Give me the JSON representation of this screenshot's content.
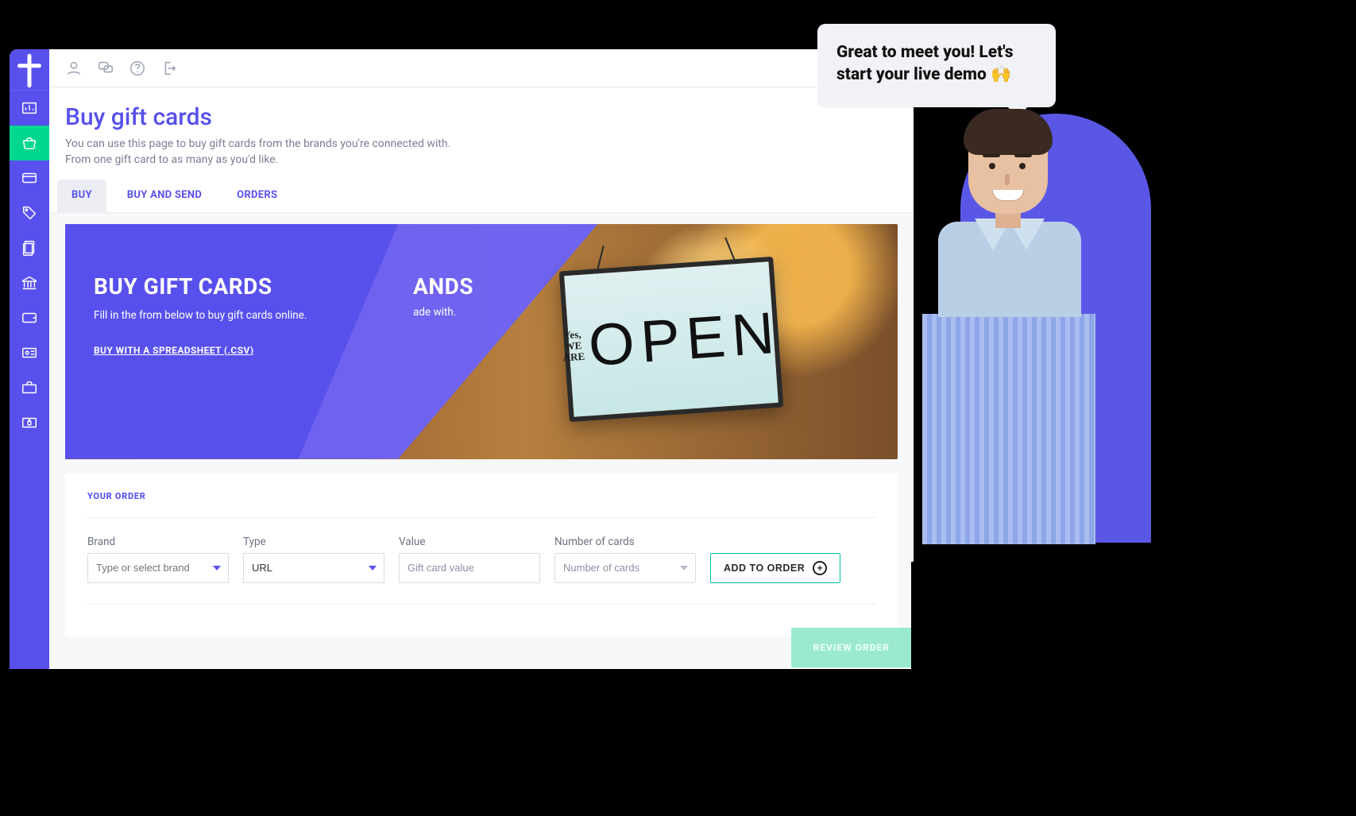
{
  "colors": {
    "primary": "#5850ec",
    "accent": "#00d68f",
    "teal": "#00bfa5"
  },
  "sidebar": {
    "items": [
      {
        "name": "dashboard-icon"
      },
      {
        "name": "basket-icon",
        "active": true
      },
      {
        "name": "card-icon"
      },
      {
        "name": "tag-icon"
      },
      {
        "name": "papers-icon"
      },
      {
        "name": "bank-icon"
      },
      {
        "name": "wallet-icon"
      },
      {
        "name": "id-icon"
      },
      {
        "name": "briefcase-icon"
      },
      {
        "name": "lock-card-icon"
      }
    ]
  },
  "header_icons": [
    {
      "name": "user-icon"
    },
    {
      "name": "chat-icon"
    },
    {
      "name": "help-icon"
    },
    {
      "name": "logout-icon"
    }
  ],
  "page": {
    "title": "Buy gift cards",
    "subtitle": "You can use this page to buy gift cards from the brands you're connected with. From one gift card to as many as you'd like."
  },
  "tabs": [
    {
      "label": "BUY",
      "active": true
    },
    {
      "label": "BUY AND SEND"
    },
    {
      "label": "ORDERS"
    }
  ],
  "hero": {
    "title": "BUY GIFT CARDS",
    "body": "Fill in the from below to buy gift cards online.",
    "link": "BUY WITH A SPREADSHEET (.CSV)",
    "peek_title": "ANDS",
    "peek_sub": "ade with.",
    "sign_small": "Yes,\nWE ARE",
    "sign_big": "OPEN"
  },
  "order": {
    "section_title": "YOUR ORDER",
    "fields": {
      "brand": {
        "label": "Brand",
        "placeholder": "Type or select brand"
      },
      "type": {
        "label": "Type",
        "value": "URL"
      },
      "value": {
        "label": "Value",
        "placeholder": "Gift card value"
      },
      "number": {
        "label": "Number of cards",
        "placeholder": "Number of cards"
      }
    },
    "add_label": "ADD TO ORDER",
    "review_label": "REVIEW ORDER"
  },
  "demo": {
    "speech": "Great to meet you! Let's start your live demo 🙌"
  }
}
